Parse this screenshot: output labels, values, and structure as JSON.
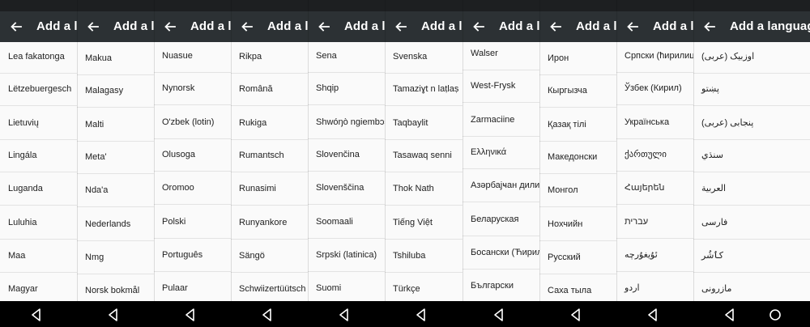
{
  "app": {
    "title": "Add a language",
    "title_clipped": "Add a lar"
  },
  "icons": {
    "back": "arrow-back-icon",
    "nav_back": "triangle-back-icon",
    "nav_home": "circle-home-icon"
  },
  "colors": {
    "appbar": "#2c3134",
    "list_bg": "#fafafa",
    "navbar": "#000000",
    "text": "#212121"
  },
  "panels": [
    {
      "title": "Add a lar",
      "items": [
        "Lea fakatonga",
        "Lëtzebuergesch",
        "Lietuvių",
        "Lingála",
        "Luganda",
        "Luluhia",
        "Maa",
        "Magyar"
      ]
    },
    {
      "title": "Add a lar",
      "items": [
        "Makua",
        "Malagasy",
        "Malti",
        "Meta'",
        "Nda'a",
        "Nederlands",
        "Nmg",
        "Norsk bokmål"
      ]
    },
    {
      "title": "Add a lar",
      "items": [
        "Nuasue",
        "Nynorsk",
        "O'zbek (lotin)",
        "Olusoga",
        "Oromoo",
        "Polski",
        "Português",
        "Pulaar"
      ]
    },
    {
      "title": "Add a lar",
      "items": [
        "Rikpa",
        "Română",
        "Rukiga",
        "Rumantsch",
        "Runasimi",
        "Runyankore",
        "Sängö",
        "Schwiizertüütsch"
      ]
    },
    {
      "title": "Add a lar",
      "items": [
        "Sena",
        "Shqip",
        "Shwóŋò ngiembɔɔn",
        "Slovenčina",
        "Slovenščina",
        "Soomaali",
        "Srpski (latinica)",
        "Suomi"
      ]
    },
    {
      "title": "Add a lar",
      "items": [
        "Svenska",
        "Tamaziɣt n laṭlaṣ",
        "Taqbaylit",
        "Tasawaq senni",
        "Thok Nath",
        "Tiếng Việt",
        "Tshiluba",
        "Türkçe"
      ]
    },
    {
      "title": "Add a lar",
      "items": [
        "Walser",
        "West-Frysk",
        "Zarmaciine",
        "Ελληνικά",
        "Азәрбајҹан дили (к",
        "Беларуская",
        "Босански (Ћирил",
        "Български"
      ]
    },
    {
      "title": "Add a lar",
      "items": [
        "Ирон",
        "Кыргызча",
        "Қазақ тілі",
        "Македонски",
        "Монгол",
        "Нохчийн",
        "Русский",
        "Саха тыла"
      ]
    },
    {
      "title": "Add a lar",
      "items": [
        "Српски (ћирилица",
        "Ўзбек (Кирил)",
        "Українська",
        "ქართული",
        "Հայերեն",
        "עברית",
        "ئۇيغۇرچە",
        "اردو"
      ]
    },
    {
      "title": "Add a language",
      "items": [
        "اوزبیک (عربی)",
        "پښتو",
        "پنجابی (عربی)",
        "سنڌي",
        "العربية",
        "فارسی",
        "کٲشُر",
        "مازرونی"
      ]
    }
  ]
}
